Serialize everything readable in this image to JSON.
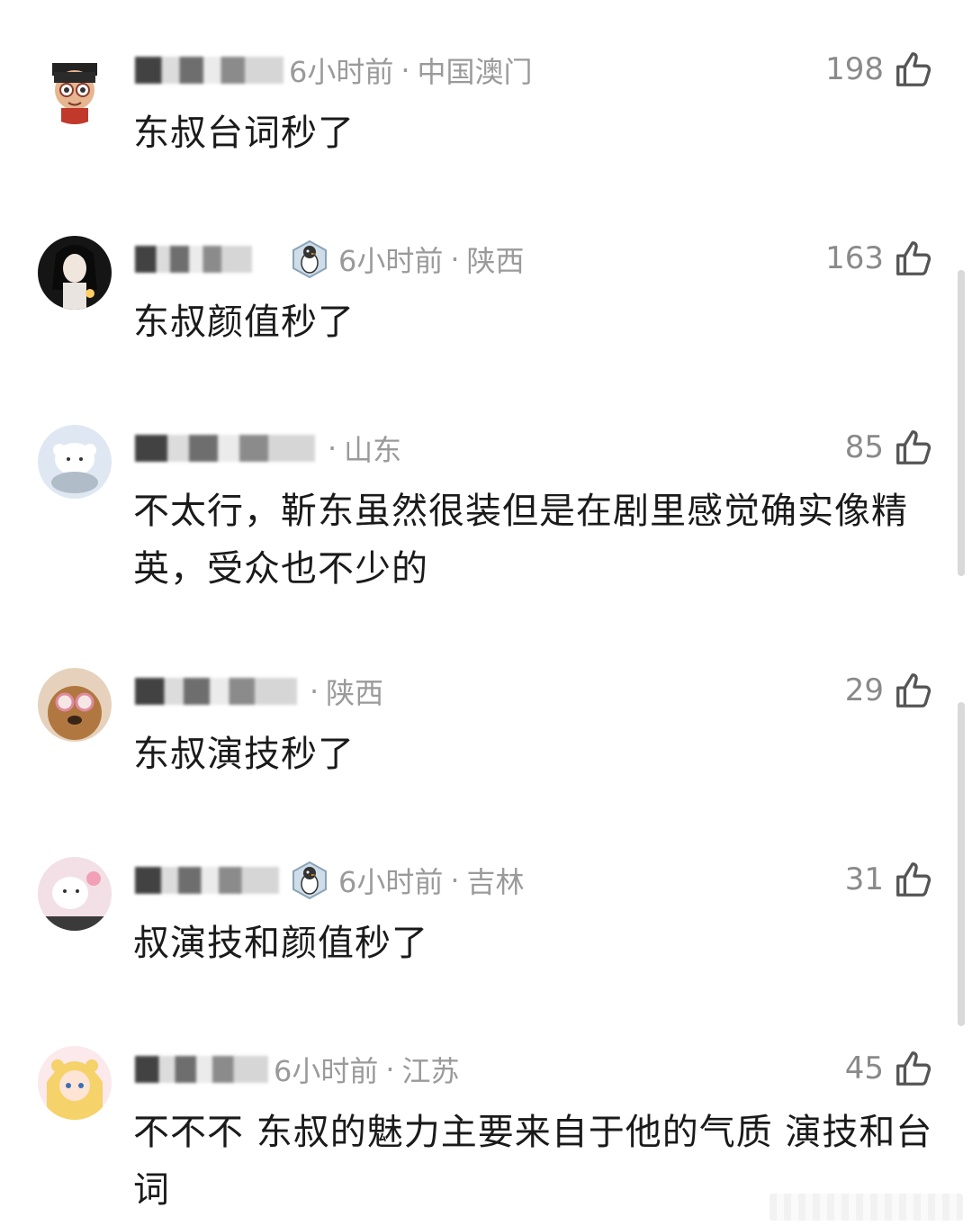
{
  "comments": [
    {
      "time": "6小时前",
      "location": "中国澳门",
      "likes": "198",
      "text": "东叔台词秒了",
      "has_badge": false
    },
    {
      "time": "6小时前",
      "location": "陕西",
      "likes": "163",
      "text": "东叔颜值秒了",
      "has_badge": true
    },
    {
      "time": "",
      "location": "山东",
      "likes": "85",
      "text": "不太行，靳东虽然很装但是在剧里感觉确实像精英，受众也不少的",
      "has_badge": false
    },
    {
      "time": "",
      "location": "陕西",
      "likes": "29",
      "text": "东叔演技秒了",
      "has_badge": false
    },
    {
      "time": "6小时前",
      "location": "吉林",
      "likes": "31",
      "text": "叔演技和颜值秒了",
      "has_badge": true
    },
    {
      "time": "6小时前",
      "location": "江苏",
      "likes": "45",
      "text": "不不不 东叔的魅力主要来自于他的气质 演技和台词",
      "has_badge": false
    }
  ],
  "separator": "·",
  "icons": {
    "like": "thumbs-up-icon",
    "badge": "penguin-badge-icon"
  },
  "colors": {
    "meta": "#9a9a9a",
    "text": "#1a1a1a",
    "likes": "#8a8a8a"
  }
}
